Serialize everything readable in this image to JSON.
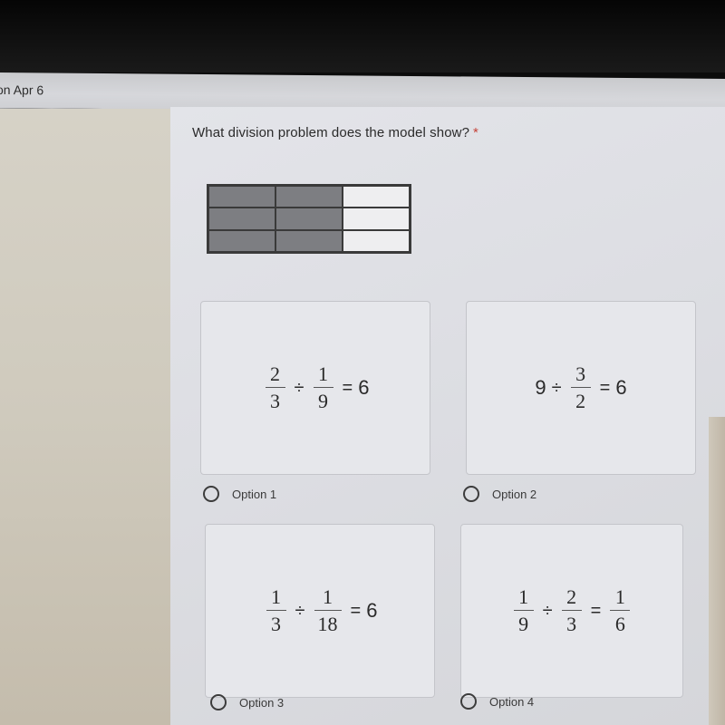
{
  "header": {
    "date_label": "on Apr 6"
  },
  "question": {
    "text": "What division problem does the model show?",
    "required_marker": "*"
  },
  "model": {
    "rows": 3,
    "columns": 3,
    "shaded_columns": 2,
    "shaded_color": "#7d7e82"
  },
  "options": [
    {
      "label": "Option 1",
      "equation": {
        "terms": [
          {
            "type": "fraction",
            "num": "2",
            "den": "3"
          },
          {
            "type": "op",
            "text": "÷"
          },
          {
            "type": "fraction",
            "num": "1",
            "den": "9"
          },
          {
            "type": "op",
            "text": "="
          },
          {
            "type": "whole",
            "text": "6"
          }
        ]
      },
      "selected": false
    },
    {
      "label": "Option 2",
      "equation": {
        "terms": [
          {
            "type": "whole",
            "text": "9"
          },
          {
            "type": "op",
            "text": "÷"
          },
          {
            "type": "fraction",
            "num": "3",
            "den": "2"
          },
          {
            "type": "op",
            "text": "="
          },
          {
            "type": "whole",
            "text": "6"
          }
        ]
      },
      "selected": false
    },
    {
      "label": "Option 3",
      "equation": {
        "terms": [
          {
            "type": "fraction",
            "num": "1",
            "den": "3"
          },
          {
            "type": "op",
            "text": "÷"
          },
          {
            "type": "fraction",
            "num": "1",
            "den": "18"
          },
          {
            "type": "op",
            "text": "="
          },
          {
            "type": "whole",
            "text": "6"
          }
        ]
      },
      "selected": false
    },
    {
      "label": "Option 4",
      "equation": {
        "terms": [
          {
            "type": "fraction",
            "num": "1",
            "den": "9"
          },
          {
            "type": "op",
            "text": "÷"
          },
          {
            "type": "fraction",
            "num": "2",
            "den": "3"
          },
          {
            "type": "op",
            "text": "="
          },
          {
            "type": "fraction",
            "num": "1",
            "den": "6"
          }
        ]
      },
      "selected": false
    }
  ]
}
